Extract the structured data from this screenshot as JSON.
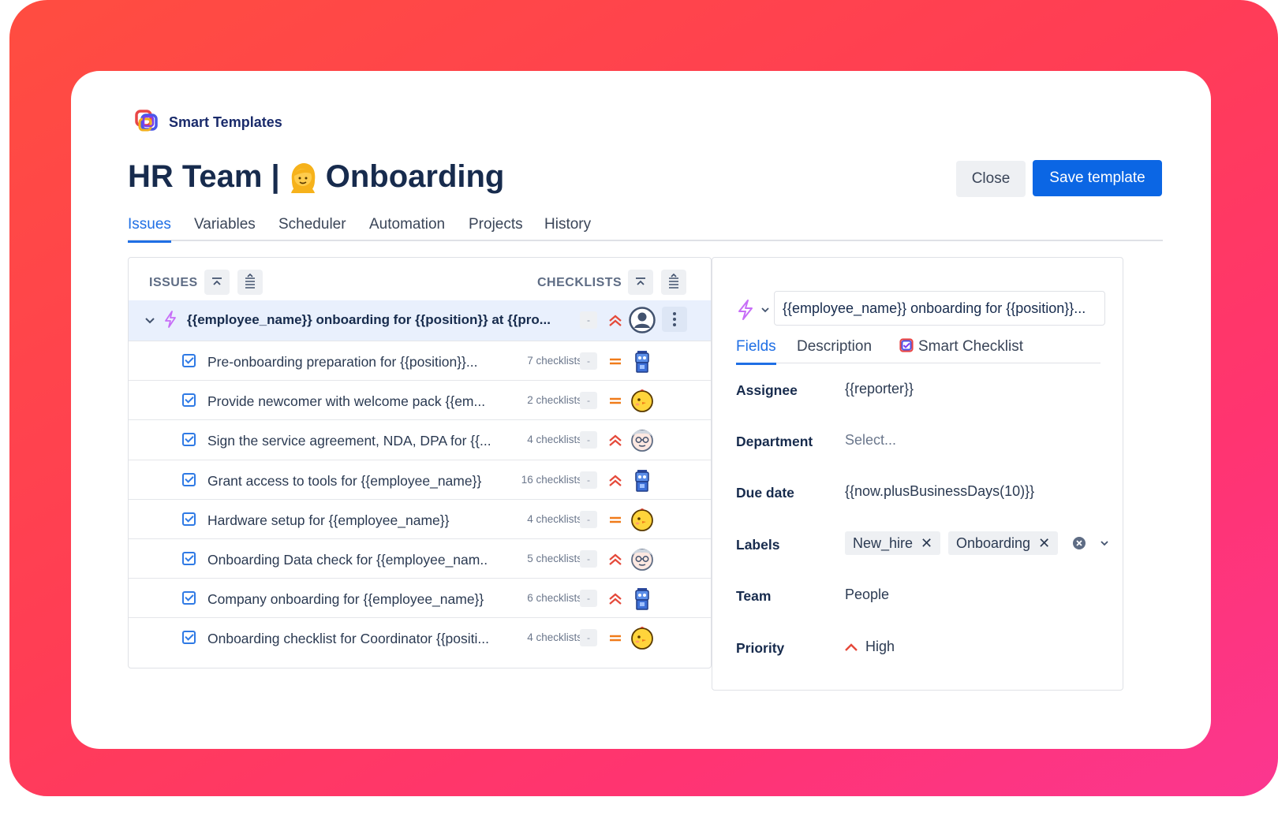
{
  "brand": {
    "name": "Smart Templates"
  },
  "header": {
    "title_prefix": "HR Team |",
    "title_suffix": "Onboarding",
    "close_label": "Close",
    "save_label": "Save template"
  },
  "tabs": [
    "Issues",
    "Variables",
    "Scheduler",
    "Automation",
    "Projects",
    "History"
  ],
  "left_panel": {
    "issues_header": "ISSUES",
    "checklists_header": "CHECKLISTS",
    "parent": {
      "title": "{{employee_name}} onboarding for {{position}} at {{pro...",
      "count": "-"
    },
    "children": [
      {
        "title": "Pre-onboarding preparation for {{position}}...",
        "count": "7 checklists",
        "dash": "-",
        "priority": "medium",
        "avatar": "robot"
      },
      {
        "title": "Provide newcomer with welcome pack {{em...",
        "count": "2 checklists",
        "dash": "-",
        "priority": "medium",
        "avatar": "chick"
      },
      {
        "title": "Sign the service agreement, NDA, DPA for {{...",
        "count": "4 checklists",
        "dash": "-",
        "priority": "high",
        "avatar": "scientist"
      },
      {
        "title": "Grant access to tools for {{employee_name}}",
        "count": "16 checklists",
        "dash": "-",
        "priority": "high",
        "avatar": "robot"
      },
      {
        "title": "Hardware setup for {{employee_name}}",
        "count": "4 checklists",
        "dash": "-",
        "priority": "medium",
        "avatar": "chick"
      },
      {
        "title": "Onboarding Data check for {{employee_nam..",
        "count": "5 checklists",
        "dash": "-",
        "priority": "high",
        "avatar": "scientist"
      },
      {
        "title": "Company onboarding for {{employee_name}}",
        "count": "6 checklists",
        "dash": "-",
        "priority": "high",
        "avatar": "robot"
      },
      {
        "title": "Onboarding checklist for Coordinator {{positi...",
        "count": "4 checklists",
        "dash": "-",
        "priority": "medium",
        "avatar": "chick"
      }
    ]
  },
  "right_panel": {
    "summary_value": "{{employee_name}} onboarding for {{position}}...",
    "tabs": [
      "Fields",
      "Description",
      "Smart Checklist"
    ],
    "fields": {
      "assignee_label": "Assignee",
      "assignee_value": "{{reporter}}",
      "department_label": "Department",
      "department_placeholder": "Select...",
      "due_label": "Due date",
      "due_value": "{{now.plusBusinessDays(10)}}",
      "labels_label": "Labels",
      "labels": [
        "New_hire",
        "Onboarding"
      ],
      "team_label": "Team",
      "team_value": "People",
      "priority_label": "Priority",
      "priority_value": "High"
    }
  },
  "colors": {
    "accent": "#0b66e4",
    "priority_high": "#e5493a",
    "priority_medium": "#f07b1a",
    "bolt": "#c76ef7"
  }
}
